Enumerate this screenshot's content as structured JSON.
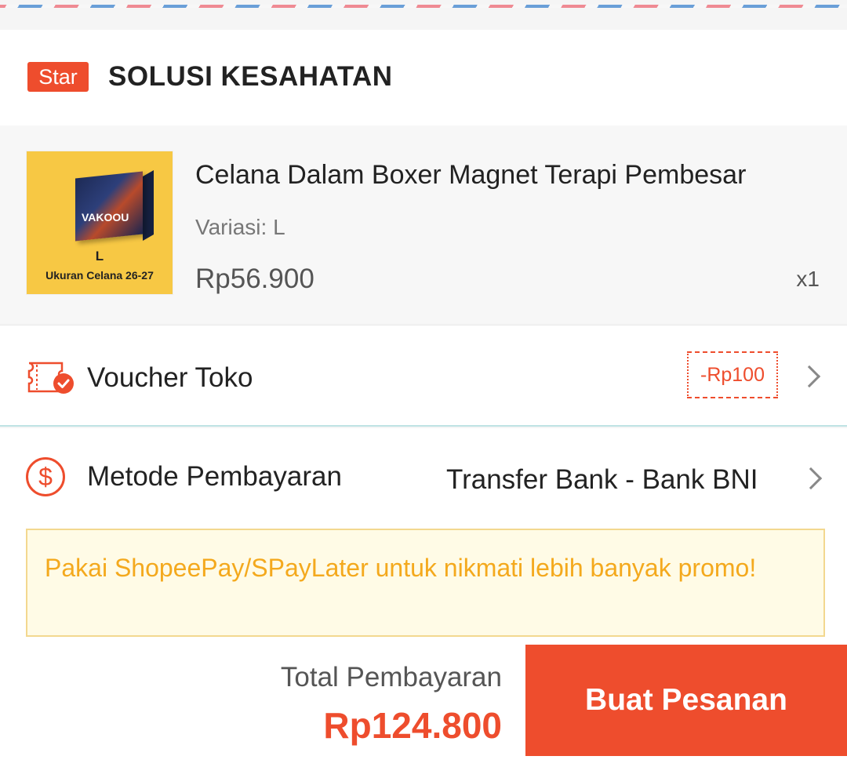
{
  "shop": {
    "badge": "Star",
    "name": "SOLUSI KESAHATAN"
  },
  "product": {
    "title": "Celana Dalam Boxer Magnet Terapi Pembesar",
    "variation": "Variasi: L",
    "price": "Rp56.900",
    "quantity": "x1",
    "thumbnail": {
      "box_text": "VAKOOU",
      "size": "L",
      "caption": "Ukuran Celana 26-27"
    }
  },
  "voucher": {
    "label": "Voucher Toko",
    "discount": "-Rp100",
    "icon": "voucher-check-icon"
  },
  "payment": {
    "label": "Metode Pembayaran",
    "value": "Transfer Bank - Bank BNI",
    "icon": "dollar-circle-icon",
    "promo": "Pakai ShopeePay/SPayLater untuk nikmati lebih banyak promo!"
  },
  "footer": {
    "total_label": "Total Pembayaran",
    "total_value": "Rp124.800",
    "order_button": "Buat Pesanan"
  },
  "colors": {
    "accent": "#ee4d2d",
    "promo_text": "#f4a91d",
    "promo_bg": "#fffbe6"
  }
}
